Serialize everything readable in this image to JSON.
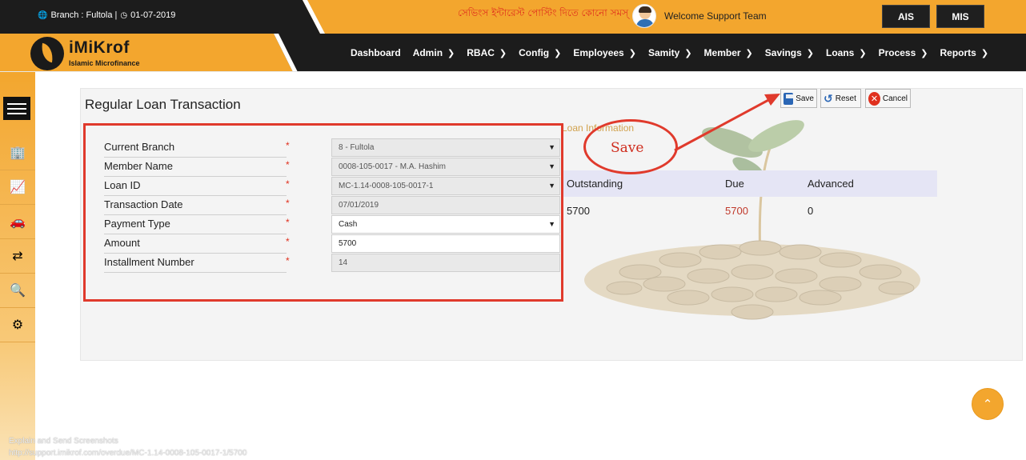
{
  "topbar": {
    "branch_label": "Branch : Fultola |",
    "date": "01-07-2019",
    "marquee_text": "সেভিংস ইন্টারেস্ট পোস্টিং দিতে কোনো সমস্",
    "welcome_text": "Welcome Support Team",
    "ais_label": "AIS",
    "mis_label": "MIS"
  },
  "logo": {
    "title": "iMiKrof",
    "subtitle": "Islamic Microfinance"
  },
  "nav": [
    {
      "label": "Dashboard",
      "has_menu": false
    },
    {
      "label": "Admin",
      "has_menu": true
    },
    {
      "label": "RBAC",
      "has_menu": true
    },
    {
      "label": "Config",
      "has_menu": true
    },
    {
      "label": "Employees",
      "has_menu": true
    },
    {
      "label": "Samity",
      "has_menu": true
    },
    {
      "label": "Member",
      "has_menu": true
    },
    {
      "label": "Savings",
      "has_menu": true
    },
    {
      "label": "Loans",
      "has_menu": true
    },
    {
      "label": "Process",
      "has_menu": true
    },
    {
      "label": "Reports",
      "has_menu": true
    }
  ],
  "sidebar_icons": [
    "building-icon",
    "chart-icon",
    "car-icon",
    "transfer-icon",
    "search-settings-icon",
    "network-icon"
  ],
  "page": {
    "title": "Regular Loan Transaction",
    "buttons": {
      "save": "Save",
      "reset": "Reset",
      "cancel": "Cancel"
    }
  },
  "form": {
    "rows": [
      {
        "label": "Current Branch",
        "value": "8 - Fultola",
        "type": "select",
        "readonly": true
      },
      {
        "label": "Member Name",
        "value": "0008-105-0017 - M.A. Hashim",
        "type": "select",
        "readonly": true
      },
      {
        "label": "Loan ID",
        "value": "MC-1.14-0008-105-0017-1",
        "type": "select",
        "readonly": true
      },
      {
        "label": "Transaction Date",
        "value": "07/01/2019",
        "type": "text",
        "readonly": true
      },
      {
        "label": "Payment Type",
        "value": "Cash",
        "type": "select",
        "readonly": false
      },
      {
        "label": "Amount",
        "value": "5700",
        "type": "text",
        "readonly": false
      },
      {
        "label": "Installment Number",
        "value": "14",
        "type": "text",
        "readonly": true
      }
    ]
  },
  "loan_info": {
    "heading": "Loan Information",
    "annotation": "Save",
    "columns": [
      "Outstanding",
      "Due",
      "Advanced"
    ],
    "values": [
      "5700",
      "5700",
      "0"
    ]
  },
  "footer": {
    "line1": "Explain and Send Screenshots",
    "line2": "http://support.imikrof.com/overdue/MC-1.14-0008-105-0017-1/5700"
  },
  "colors": {
    "accent": "#f3a62e",
    "dark": "#1c1c1c",
    "annotation_red": "#e03a2c"
  }
}
